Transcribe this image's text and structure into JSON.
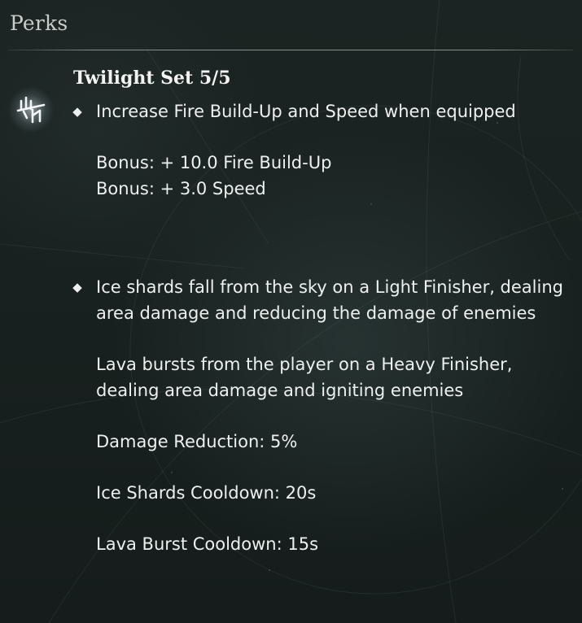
{
  "panel": {
    "header": "Perks"
  },
  "set": {
    "icon": "set-sigil-icon",
    "title": "Twilight Set 5/5"
  },
  "perks": [
    {
      "bullet": "◆",
      "paragraphs": [
        "Increase Fire Build-Up and Speed when equipped",
        "Bonus: + 10.0 Fire Build-Up\nBonus: + 3.0 Speed"
      ]
    },
    {
      "bullet": "◆",
      "paragraphs": [
        "Ice shards fall from the sky on a Light Finisher, dealing area damage and reducing the damage of enemies",
        "Lava bursts from the player on a Heavy Finisher, dealing area damage and igniting enemies",
        "Damage Reduction: 5%",
        "Ice Shards Cooldown: 20s",
        "Lava Burst Cooldown: 15s"
      ]
    }
  ]
}
